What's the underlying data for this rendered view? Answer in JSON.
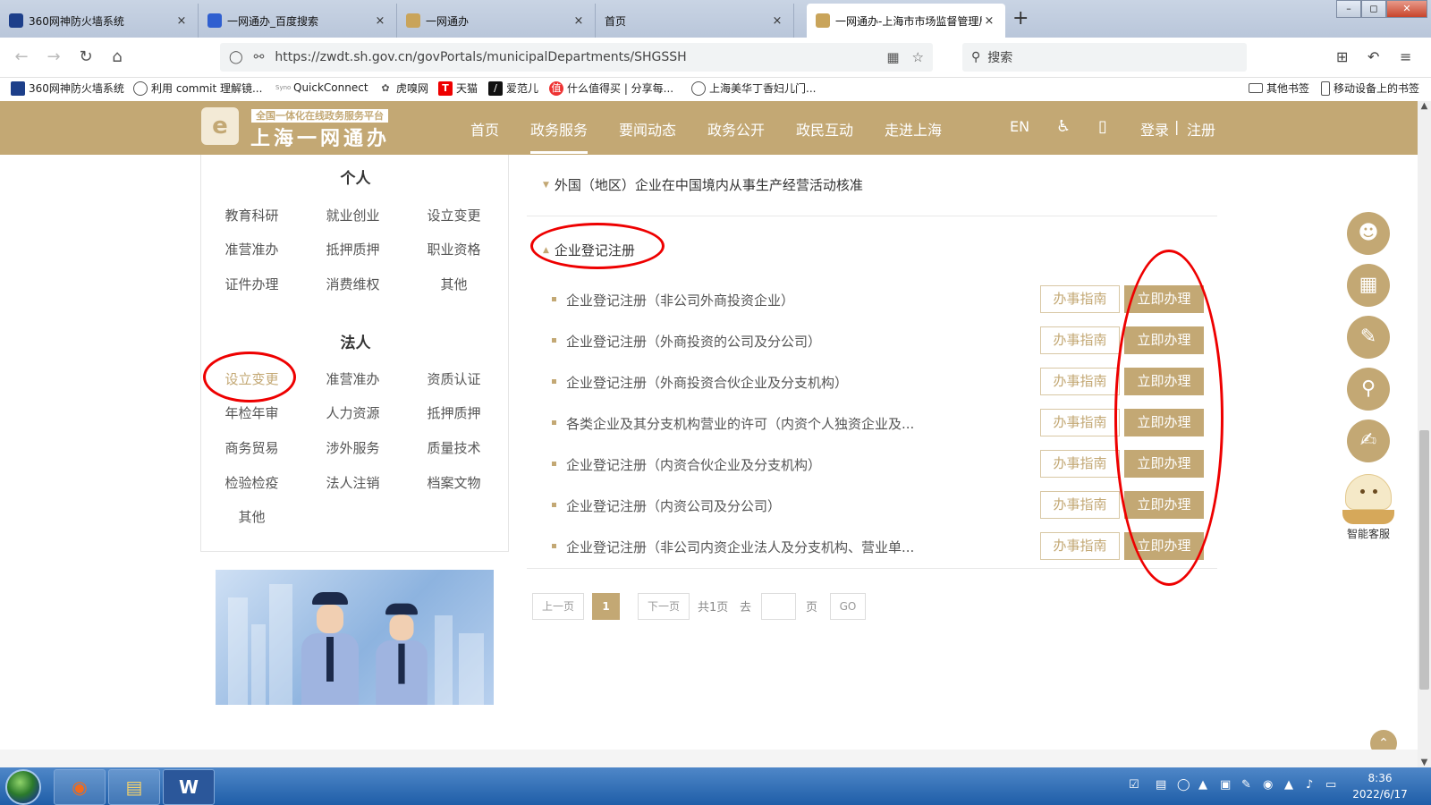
{
  "browser": {
    "tabs": [
      {
        "label": "360网神防火墙系统",
        "close": "×"
      },
      {
        "label": "一网通办_百度搜索",
        "close": "×"
      },
      {
        "label": "一网通办",
        "close": "×"
      },
      {
        "label": "首页",
        "close": "×"
      },
      {
        "label": "一网通办-上海市市场监督管理局",
        "close": "×"
      }
    ],
    "new_tab": "+",
    "url": "https://zwdt.sh.gov.cn/govPortals/municipalDepartments/SHGSSH",
    "search_placeholder": "搜索",
    "bookmarks": [
      {
        "label": "360网神防火墙系统",
        "icon": "360-icon"
      },
      {
        "label": "利用 commit 理解镜...",
        "icon": "globe-icon"
      },
      {
        "label": "QuickConnect",
        "icon": "synology-icon"
      },
      {
        "label": "虎嗅网",
        "icon": "huxiu-icon"
      },
      {
        "label": "天猫",
        "icon": "tmall-icon"
      },
      {
        "label": "爱范儿",
        "icon": "ifanr-icon"
      },
      {
        "label": "什么值得买 | 分享每...",
        "icon": "smzdm-icon"
      },
      {
        "label": "上海美华丁香妇儿门...",
        "icon": "globe-icon"
      }
    ],
    "bookmarks_right": [
      {
        "label": "其他书签"
      },
      {
        "label": "移动设备上的书签"
      }
    ]
  },
  "site": {
    "logo_top": "全国一体化在线政务服务平台",
    "logo_main": "上海一网通办",
    "nav": [
      "首页",
      "政务服务",
      "要闻动态",
      "政务公开",
      "政民互动",
      "走进上海"
    ],
    "nav_active": "政务服务",
    "lang": "EN",
    "login": "登录",
    "separator": "|",
    "register": "注册"
  },
  "sidebar": {
    "personal_title": "个人",
    "personal": [
      "教育科研",
      "就业创业",
      "设立变更",
      "准营准办",
      "抵押质押",
      "职业资格",
      "证件办理",
      "消费维权",
      "其他"
    ],
    "legal_title": "法人",
    "legal": [
      "设立变更",
      "准营准办",
      "资质认证",
      "年检年审",
      "人力资源",
      "抵押质押",
      "商务贸易",
      "涉外服务",
      "质量技术",
      "检验检疫",
      "法人注销",
      "档案文物",
      "其他"
    ],
    "legal_selected": "设立变更"
  },
  "content": {
    "section_prev": "外国（地区）企业在中国境内从事生产经营活动核准",
    "section_open": "企业登记注册",
    "items": [
      "企业登记注册（非公司外商投资企业）",
      "企业登记注册（外商投资的公司及分公司）",
      "企业登记注册（外商投资合伙企业及分支机构）",
      "各类企业及其分支机构营业的许可（内资个人独资企业及...",
      "企业登记注册（内资合伙企业及分支机构）",
      "企业登记注册（内资公司及分公司）",
      "企业登记注册（非公司内资企业法人及分支机构、营业单..."
    ],
    "guide_label": "办事指南",
    "apply_label": "立即办理"
  },
  "pager": {
    "prev": "上一页",
    "current": "1",
    "next": "下一页",
    "total": "共1页",
    "goto": "去",
    "page_unit": "页",
    "go": "GO"
  },
  "float_tools": {
    "bot_label": "智能客服",
    "icons": [
      "user-icon",
      "calendar-icon",
      "document-icon",
      "search-icon",
      "edit-icon"
    ]
  },
  "taskbar": {
    "time": "8:36",
    "date": "2022/6/17"
  },
  "colors": {
    "brand": "#c3a874",
    "annotation": "#e00000"
  }
}
